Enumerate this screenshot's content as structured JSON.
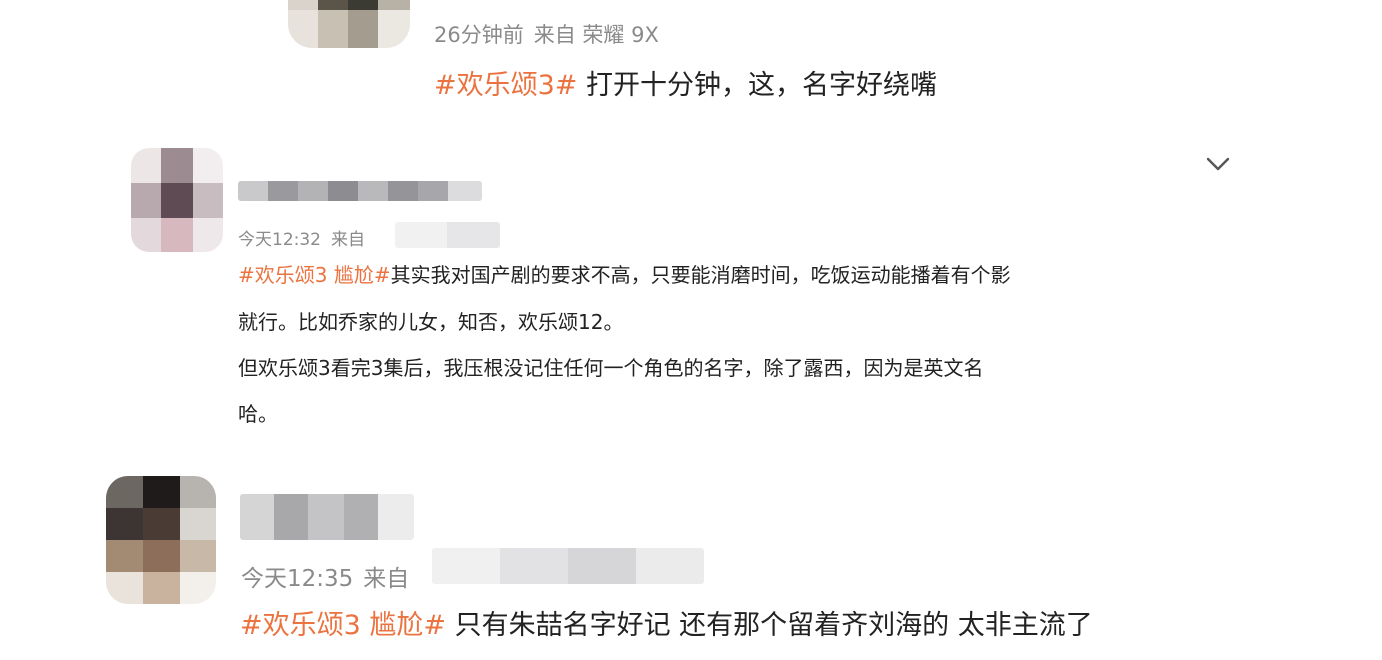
{
  "colors": {
    "accent_tag": "#eb7340",
    "meta_gray": "#8a8a8a",
    "text": "#222222",
    "background": "#ffffff"
  },
  "posts": [
    {
      "meta_time": "26分钟前",
      "meta_from": "来自 荣耀 9X",
      "tag": "#欢乐颂3#",
      "lines": [
        " 打开十分钟，这，名字好绕嘴"
      ]
    },
    {
      "meta_time": "今天12:32",
      "meta_from": "来自",
      "tag": "#欢乐颂3 尴尬#",
      "lines": [
        "其实我对国产剧的要求不高，只要能消磨时间，吃饭运动能播着有个影",
        "就行。比如乔家的儿女，知否，欢乐颂12。",
        "但欢乐颂3看完3集后，我压根没记住任何一个角色的名字，除了露西，因为是英文名",
        "哈。"
      ]
    },
    {
      "meta_time": "今天12:35",
      "meta_from": "来自",
      "tag": "#欢乐颂3 尴尬#",
      "lines": [
        " 只有朱喆名字好记 还有那个留着齐刘海的 太非主流了"
      ]
    }
  ],
  "icons": {
    "expand": "chevron-down-icon"
  }
}
